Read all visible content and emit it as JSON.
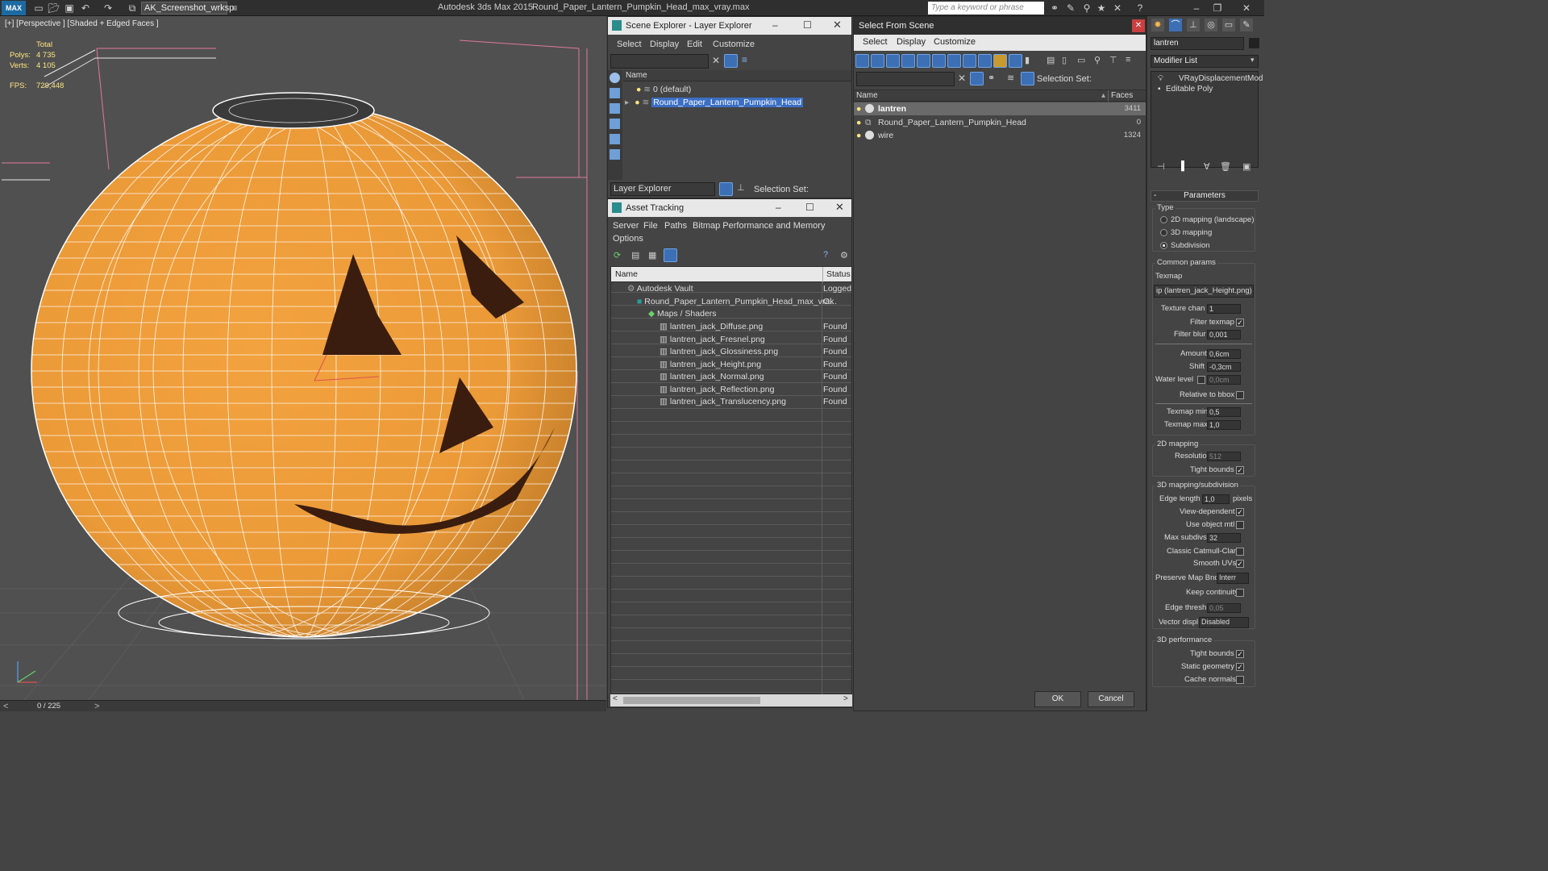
{
  "titlebar": {
    "logo": "MAX",
    "workspace": "AK_Screenshot_wrksp",
    "app_title": "Autodesk 3ds Max  2015",
    "file_title": "Round_Paper_Lantern_Pumpkin_Head_max_vray.max",
    "search_placeholder": "Type a keyword or phrase"
  },
  "viewport": {
    "label": "[+] [Perspective ] [Shaded + Edged Faces ]",
    "total_label": "Total",
    "polys_label": "Polys:",
    "polys_value": "4 735",
    "verts_label": "Verts:",
    "verts_value": "4 105",
    "fps_label": "FPS:",
    "fps_value": "729,448"
  },
  "timeline": {
    "frame": "0 / 225"
  },
  "scene_explorer": {
    "title": "Scene Explorer - Layer Explorer",
    "menu": [
      "Select",
      "Display",
      "Edit",
      "Customize"
    ],
    "column_name": "Name",
    "layers": [
      "0 (default)",
      "Round_Paper_Lantern_Pumpkin_Head"
    ],
    "footer_dropdown": "Layer Explorer",
    "selection_set_label": "Selection Set:"
  },
  "asset_tracking": {
    "title": "Asset Tracking",
    "menu": [
      "Server",
      "File",
      "Paths",
      "Bitmap Performance and Memory",
      "Options"
    ],
    "col_name": "Name",
    "col_status": "Status",
    "rows": [
      {
        "name": "Autodesk Vault",
        "status": "Logged"
      },
      {
        "name": "Round_Paper_Lantern_Pumpkin_Head_max_vra...",
        "status": "Ok"
      },
      {
        "name": "Maps / Shaders",
        "status": ""
      },
      {
        "name": "lantren_jack_Diffuse.png",
        "status": "Found"
      },
      {
        "name": "lantren_jack_Fresnel.png",
        "status": "Found"
      },
      {
        "name": "lantren_jack_Glossiness.png",
        "status": "Found"
      },
      {
        "name": "lantren_jack_Height.png",
        "status": "Found"
      },
      {
        "name": "lantren_jack_Normal.png",
        "status": "Found"
      },
      {
        "name": "lantren_jack_Reflection.png",
        "status": "Found"
      },
      {
        "name": "lantren_jack_Translucency.png",
        "status": "Found"
      }
    ]
  },
  "select_from_scene": {
    "title": "Select From Scene",
    "menu": [
      "Select",
      "Display",
      "Customize"
    ],
    "selection_set_label": "Selection Set:",
    "col_name": "Name",
    "col_faces": "Faces",
    "rows": [
      {
        "name": "lantren",
        "faces": "3411"
      },
      {
        "name": "Round_Paper_Lantern_Pumpkin_Head",
        "faces": "0"
      },
      {
        "name": "wire",
        "faces": "1324"
      }
    ],
    "ok": "OK",
    "cancel": "Cancel"
  },
  "modify": {
    "object_name": "lantren",
    "modifier_list": "Modifier List",
    "stack": [
      "VRayDisplacementMod",
      "Editable Poly"
    ],
    "parameters": "Parameters",
    "type_label": "Type",
    "type_options": [
      "2D mapping (landscape)",
      "3D mapping",
      "Subdivision"
    ],
    "common_params": "Common params",
    "texmap_label": "Texmap",
    "texmap_value": "ip (lantren_jack_Height.png)",
    "texture_chan_label": "Texture chan",
    "texture_chan_value": "1",
    "filter_texmap_label": "Filter texmap",
    "filter_blur_label": "Filter blur",
    "filter_blur_value": "0,001",
    "amount_label": "Amount",
    "amount_value": "0,6cm",
    "shift_label": "Shift",
    "shift_value": "-0,3cm",
    "water_level_label": "Water level",
    "water_level_value": "0,0cm",
    "relative_bbox_label": "Relative to bbox",
    "texmap_min_label": "Texmap min",
    "texmap_min_value": "0,5",
    "texmap_max_label": "Texmap max",
    "texmap_max_value": "1,0",
    "mapping_2d": "2D mapping",
    "resolution_label": "Resolution",
    "resolution_value": "512",
    "tight_bounds_label": "Tight bounds",
    "mapping_3d": "3D mapping/subdivision",
    "edge_length_label": "Edge length",
    "edge_length_value": "1,0",
    "pixels_label": "pixels",
    "view_dependent_label": "View-dependent",
    "use_object_mtl_label": "Use object mtl",
    "max_subdivs_label": "Max subdivs",
    "max_subdivs_value": "32",
    "classic_cc_label": "Classic Catmull-Clark",
    "smooth_uvs_label": "Smooth UVs",
    "preserve_label": "Preserve Map Bnd",
    "preserve_value": "Interr",
    "keep_continuity_label": "Keep continuity",
    "edge_thresh_label": "Edge thresh",
    "edge_thresh_value": "0,05",
    "vector_displ_label": "Vector displ",
    "vector_displ_value": "Disabled",
    "perf_3d": "3D performance",
    "tight_bounds2_label": "Tight bounds",
    "static_geometry_label": "Static geometry",
    "cache_normals_label": "Cache normals"
  },
  "colors": {
    "pumpkin": "#f0a040",
    "wire": "#ffffff",
    "selection": "#3b6fc4",
    "titlebar": "#2f2f2f"
  }
}
